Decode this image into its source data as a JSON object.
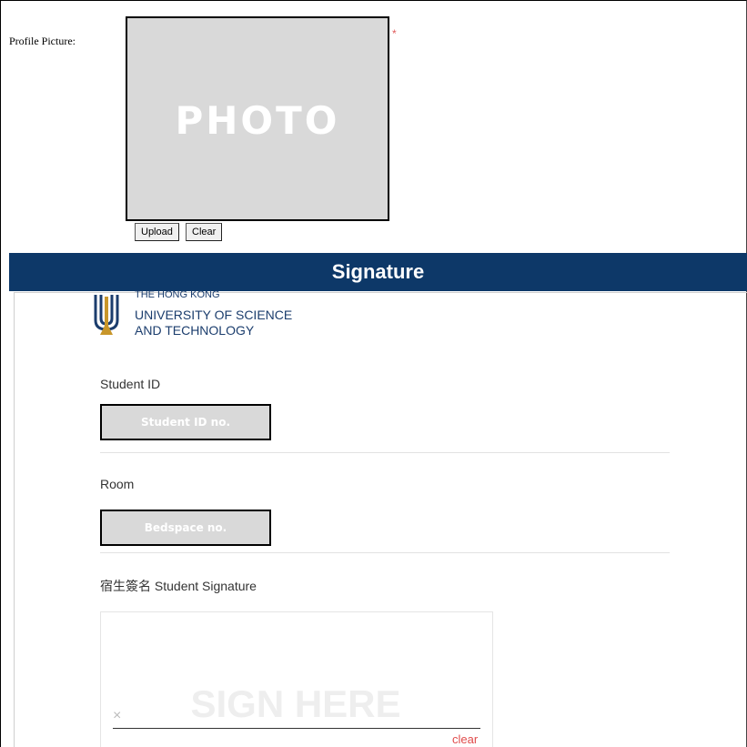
{
  "profile": {
    "label": "Profile Picture:",
    "photo_text": "PHOTO",
    "required_mark": "*",
    "upload_label": "Upload",
    "clear_label": "Clear"
  },
  "signature_section": {
    "header": "Signature",
    "logo": {
      "line_0": "THE HONG KONG",
      "line_1": "UNIVERSITY OF SCIENCE",
      "line_2": "AND TECHNOLOGY"
    },
    "student_id": {
      "label": "Student ID",
      "placeholder": "Student ID no."
    },
    "room": {
      "label": "Room",
      "placeholder": "Bedspace no."
    },
    "student_signature": {
      "label": "宿生簽名 Student Signature",
      "watermark": "SIGN HERE",
      "x_mark": "×",
      "clear_label": "clear"
    }
  },
  "colors": {
    "header_bg": "#0d3868",
    "logo_blue": "#1b3d6d",
    "logo_gold": "#c8962a",
    "placeholder_bg": "#d9d9d9",
    "clear_link": "#e04b4b"
  }
}
